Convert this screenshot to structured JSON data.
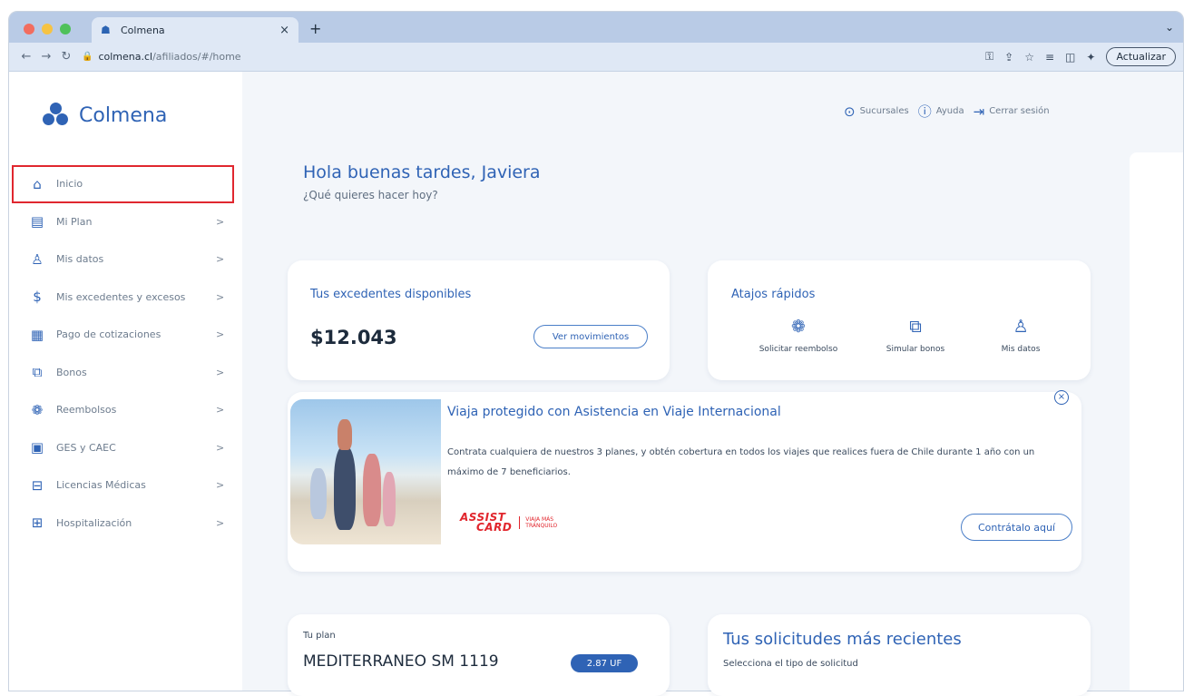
{
  "browser": {
    "tab_title": "Colmena",
    "tab_close": "×",
    "new_tab": "+",
    "url_host": "colmena.cl",
    "url_path": "/afiliados/#/home",
    "update_label": "Actualizar"
  },
  "brand": {
    "name": "Colmena",
    "color": "#2f63b5"
  },
  "sidebar": {
    "items": [
      {
        "label": "Inicio",
        "icon": "home-icon",
        "arrow": ""
      },
      {
        "label": "Mi Plan",
        "icon": "plan-document-icon",
        "arrow": ">"
      },
      {
        "label": "Mis datos",
        "icon": "user-icon",
        "arrow": ">"
      },
      {
        "label": "Mis excedentes y excesos",
        "icon": "money-icon",
        "arrow": ">"
      },
      {
        "label": "Pago de cotizaciones",
        "icon": "payment-doc-icon",
        "arrow": ">"
      },
      {
        "label": "Bonos",
        "icon": "voucher-icon",
        "arrow": ">"
      },
      {
        "label": "Reembolsos",
        "icon": "refund-icon",
        "arrow": ">"
      },
      {
        "label": "GES y CAEC",
        "icon": "ges-icon",
        "arrow": ">"
      },
      {
        "label": "Licencias Médicas",
        "icon": "medical-license-icon",
        "arrow": ">"
      },
      {
        "label": "Hospitalización",
        "icon": "hospital-icon",
        "arrow": ">"
      }
    ],
    "active_color": "#e0272f"
  },
  "topnav": {
    "branches": "Sucursales",
    "help": "Ayuda",
    "logout": "Cerrar sesión"
  },
  "greeting": {
    "title": "Hola buenas tardes, Javiera",
    "subtitle": "¿Qué quieres hacer hoy?"
  },
  "surplus": {
    "title": "Tus excedentes disponibles",
    "amount": "$12.043",
    "button": "Ver movimientos"
  },
  "shortcuts": {
    "title": "Atajos rápidos",
    "items": [
      {
        "label": "Solicitar reembolso",
        "icon": "refund-icon"
      },
      {
        "label": "Simular bonos",
        "icon": "voucher-icon"
      },
      {
        "label": "Mis datos",
        "icon": "user-icon"
      }
    ]
  },
  "banner": {
    "title": "Viaja protegido con Asistencia en Viaje Internacional",
    "text": "Contrata cualquiera de nuestros 3 planes, y obtén cobertura en todos los viajes que realices fuera de Chile durante 1 año con un máximo de 7 beneficiarios.",
    "button": "Contrátalo aquí",
    "close": "×",
    "partner_brand_line1": "ASSIST",
    "partner_brand_line2": "CARD",
    "partner_tagline_line1": "VIAJA MÁS",
    "partner_tagline_line2": "TRANQUILO"
  },
  "plan": {
    "label": "Tu plan",
    "name": "MEDITERRANEO SM 1119",
    "badge": "2.87 UF"
  },
  "requests": {
    "title": "Tus solicitudes más recientes",
    "subtitle": "Selecciona el tipo de solicitud"
  }
}
